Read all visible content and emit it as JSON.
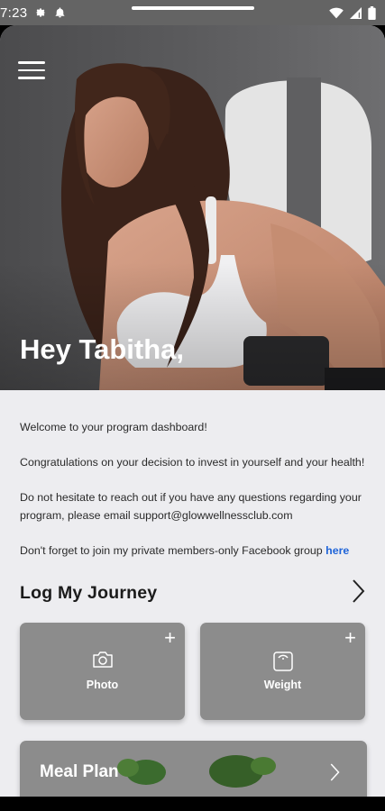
{
  "status_bar": {
    "time": "7:23"
  },
  "hero": {
    "greeting": "Hey Tabitha,"
  },
  "welcome": {
    "line1": "Welcome to your program dashboard!",
    "line2": "Congratulations on your decision to invest in yourself and your health!",
    "line3": "Do not hesitate to reach out if you have any questions regarding your program, please email support@glowwellnessclub.com",
    "line4_text": "Don't forget to join my private members-only Facebook group ",
    "line4_link": "here"
  },
  "journey": {
    "title": "Log My Journey",
    "cards": [
      {
        "label": "Photo",
        "icon": "camera-icon"
      },
      {
        "label": "Weight",
        "icon": "scale-icon"
      }
    ]
  },
  "meal_plan": {
    "label": "Meal Plan"
  },
  "colors": {
    "link": "#1f64d8",
    "card": "#8c8c8c",
    "background": "#ededf0"
  }
}
